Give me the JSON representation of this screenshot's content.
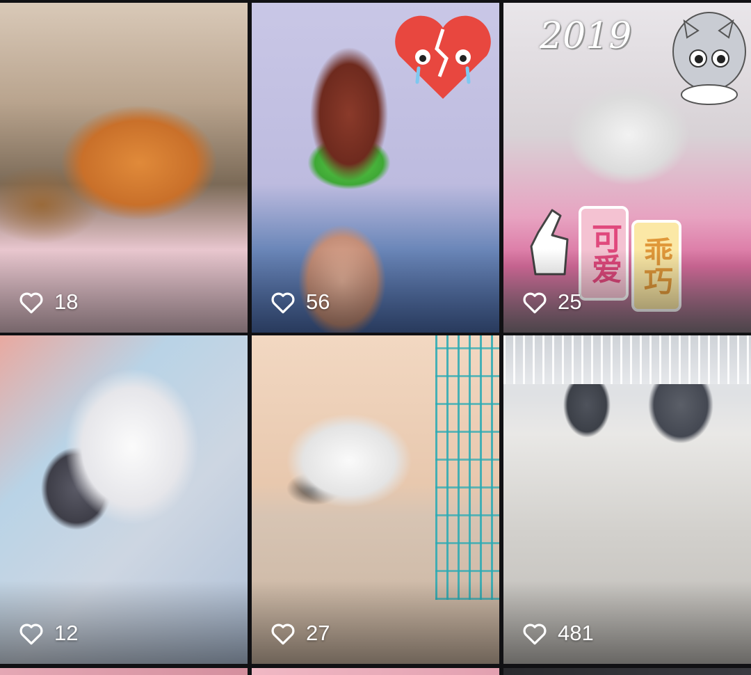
{
  "feed": {
    "posts": [
      {
        "likes": "18",
        "subject": "ginger cat sleeping in basket"
      },
      {
        "likes": "56",
        "subject": "red poodle puppy held in hand"
      },
      {
        "likes": "25",
        "subject": "white and grey cat in pink cage"
      },
      {
        "likes": "12",
        "subject": "white cat hugging grey kitten"
      },
      {
        "likes": "27",
        "subject": "persian cat lying on floor"
      },
      {
        "likes": "481",
        "subject": "two grey cats on tiled floor"
      }
    ],
    "stickers": {
      "year": "2019",
      "word_cute": "可爱",
      "word_obedient": "乖巧"
    }
  },
  "icons": {
    "like": "heart-outline-icon"
  },
  "colors": {
    "background": "#111114",
    "like_text": "#ffffff"
  }
}
